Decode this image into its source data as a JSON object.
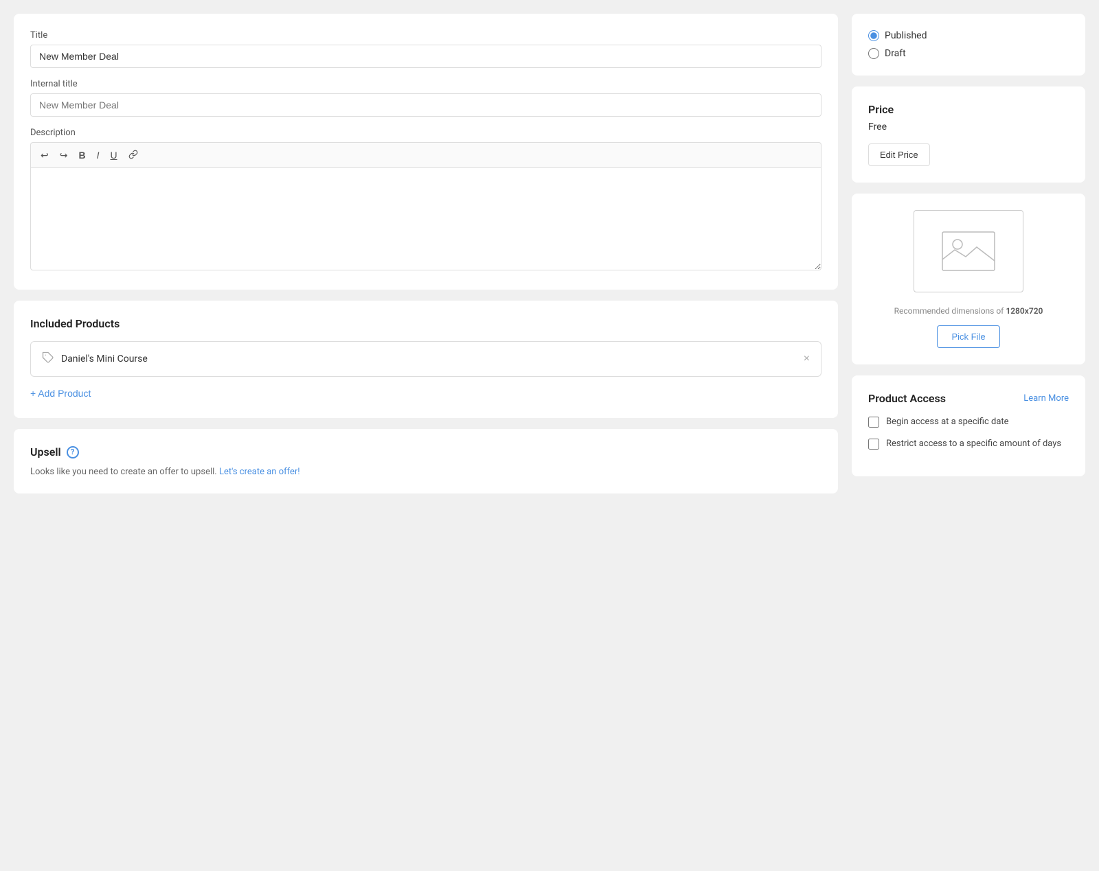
{
  "left": {
    "main_card": {
      "title_label": "Title",
      "title_value": "New Member Deal",
      "internal_title_label": "Internal title",
      "internal_title_placeholder": "New Member Deal",
      "description_label": "Description",
      "toolbar": {
        "undo": "↩",
        "redo": "↪",
        "bold": "B",
        "italic": "I",
        "underline": "U",
        "link": "🔗"
      }
    },
    "included_products": {
      "title": "Included Products",
      "products": [
        {
          "name": "Daniel's Mini Course"
        }
      ],
      "add_label": "+ Add Product"
    },
    "upsell": {
      "title": "Upsell",
      "text": "Looks like you need to create an offer to upsell.",
      "link_text": "Let's create an offer!",
      "link_href": "#"
    }
  },
  "right": {
    "status": {
      "options": [
        {
          "label": "Published",
          "value": "published",
          "checked": true
        },
        {
          "label": "Draft",
          "value": "draft",
          "checked": false
        }
      ]
    },
    "price": {
      "title": "Price",
      "value": "Free",
      "edit_label": "Edit Price"
    },
    "image": {
      "dimensions_text": "Recommended dimensions of ",
      "dimensions_value": "1280x720",
      "pick_label": "Pick File"
    },
    "product_access": {
      "title": "Product Access",
      "learn_more": "Learn More",
      "options": [
        {
          "label": "Begin access at a specific date",
          "checked": false
        },
        {
          "label": "Restrict access to a specific amount of days",
          "checked": false
        }
      ]
    }
  }
}
